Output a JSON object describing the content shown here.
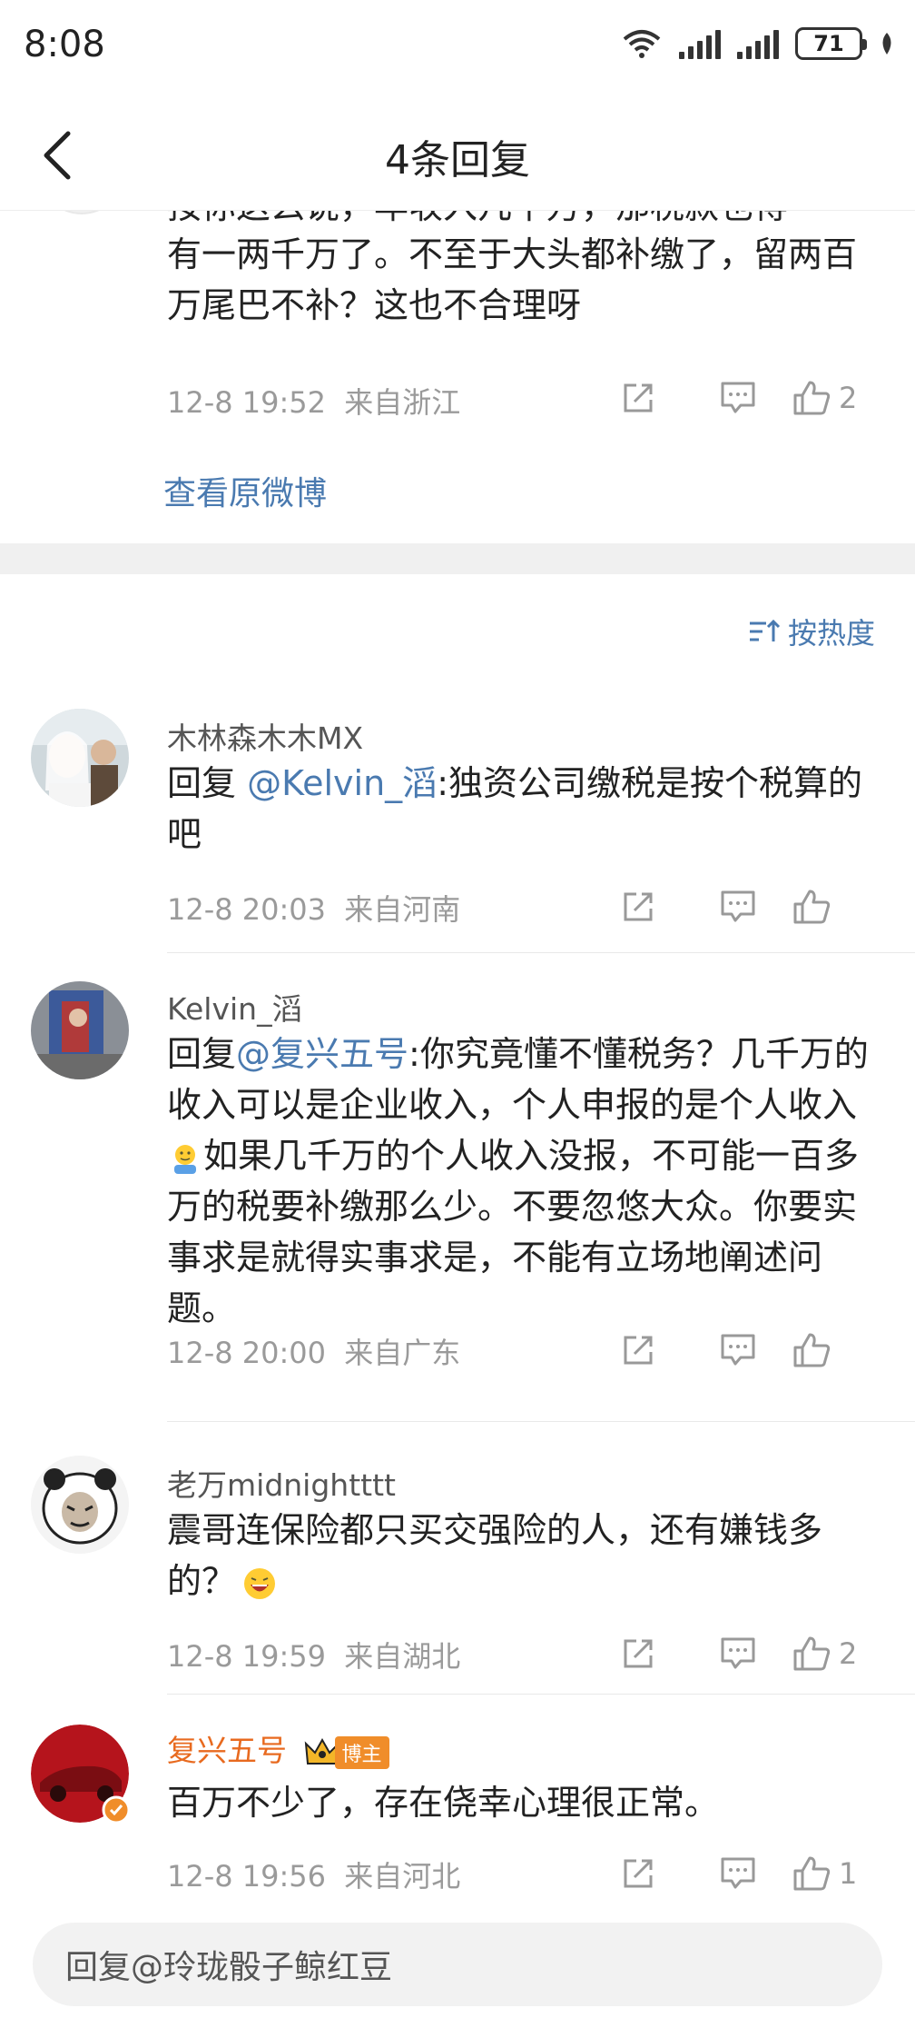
{
  "status_bar": {
    "time": "8:08",
    "battery": "71"
  },
  "header": {
    "title": "4条回复"
  },
  "original_comment": {
    "clipped_line": "按你这么说，年收入几千万，那税款也得",
    "text": "有一两千万了。不至于大头都补缴了，留两百万尾巴不补？这也不合理呀",
    "timestamp": "12-8 19:52",
    "location": "来自浙江",
    "likes": "2",
    "view_original_label": "查看原微博"
  },
  "sort": {
    "label": "按热度"
  },
  "replies": [
    {
      "username": "木林森木木MX",
      "reply_prefix": "回复 ",
      "mention": "@Kelvin_滔",
      "text": ":独资公司缴税是按个税算的吧",
      "timestamp": "12-8 20:03",
      "location": "来自河南",
      "likes": ""
    },
    {
      "username": "Kelvin_滔",
      "reply_prefix": "回复",
      "mention": "@复兴五号",
      "text_a": ":你究竟懂不懂税务？几千万的收入可以是企业收入，个人申报的是个人收入",
      "emoji": "shrug-emoji",
      "text_b": "如果几千万的个人收入没报，不可能一百多万的税要补缴那么少。不要忽悠大众。你要实事求是就得实事求是，不能有立场地阐述问题。",
      "timestamp": "12-8 20:00",
      "location": "来自广东",
      "likes": ""
    },
    {
      "username": "老万midnightttt",
      "text": "震哥连保险都只买交强险的人，还有嫌钱多的？",
      "emoji": "laughing-emoji",
      "timestamp": "12-8 19:59",
      "location": "来自湖北",
      "likes": "2"
    },
    {
      "username": "复兴五号",
      "badge": "博主",
      "text": "百万不少了，存在侥幸心理很正常。",
      "timestamp": "12-8 19:56",
      "location": "来自河北",
      "likes": "1"
    }
  ],
  "input": {
    "placeholder": "回复@玲珑骰子鲸红豆"
  },
  "colors": {
    "link": "#4a7ab0",
    "poster": "#e86a1f",
    "badge": "#f08d2a"
  }
}
